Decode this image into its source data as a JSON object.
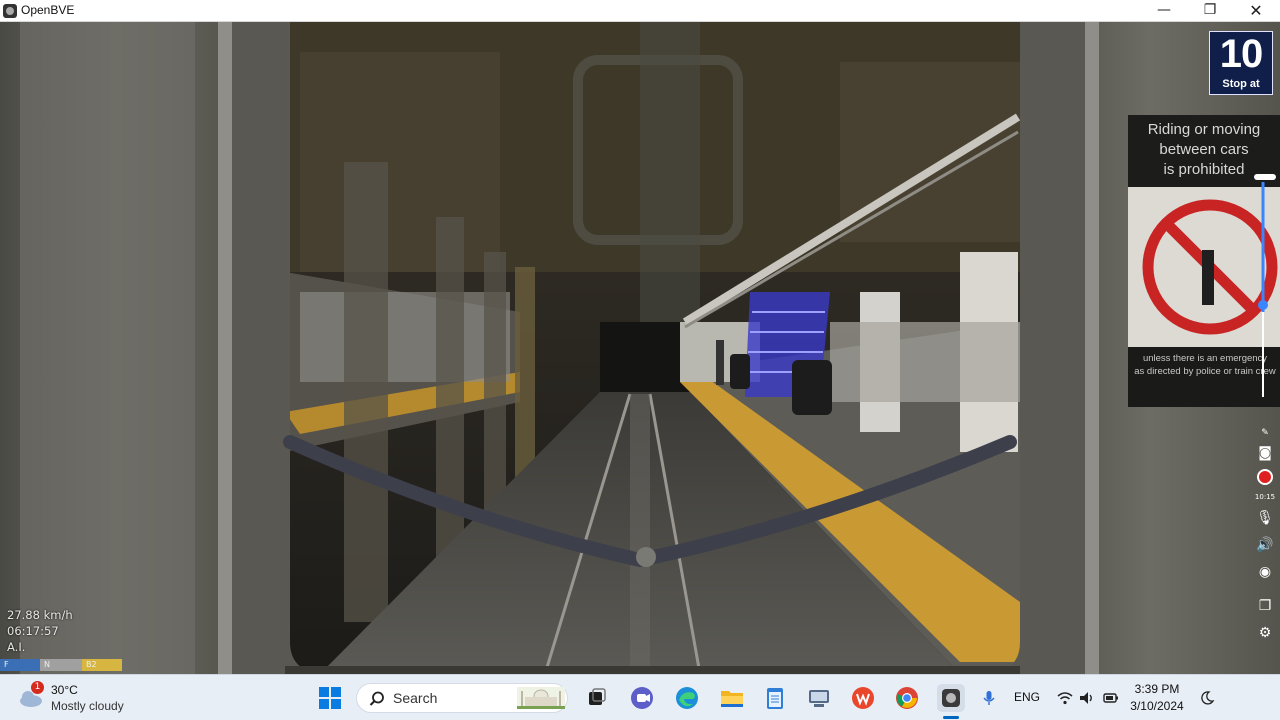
{
  "window": {
    "title": "OpenBVE",
    "minimize_glyph": "—",
    "maximize_glyph": "❐",
    "close_glyph": "✕"
  },
  "scene": {
    "stop_sign": {
      "number": "10",
      "label": "Stop at"
    },
    "poster": {
      "lines": [
        "Riding or moving",
        "between cars",
        "is prohibited"
      ],
      "fine_print": [
        "unless there is an emergency",
        "as directed by police or train crew"
      ]
    }
  },
  "hud": {
    "speed": "27.88 km/h",
    "time": "06:17:57",
    "mode": "A.I.",
    "bar_segments": [
      "F",
      "N",
      "B2"
    ],
    "bar_colors": [
      "#3a6fb5",
      "#a0a0a0",
      "#d6b640"
    ]
  },
  "screen_recorder": {
    "elapsed": "10:15",
    "icons": [
      "pen-icon",
      "camera-icon",
      "record-icon",
      "microphone-icon",
      "speaker-icon",
      "webcam-icon",
      "window-icon",
      "settings-icon"
    ]
  },
  "taskbar": {
    "weather": {
      "badge": "1",
      "temperature": "30°C",
      "description": "Mostly cloudy"
    },
    "search_label": "Search",
    "apps": [
      "task-view",
      "meet",
      "edge",
      "file-explorer",
      "notepad",
      "network-app",
      "wps-office",
      "chrome",
      "openbve"
    ],
    "tray": {
      "language": "ENG",
      "time": "3:39 PM",
      "date": "3/10/2024"
    }
  }
}
